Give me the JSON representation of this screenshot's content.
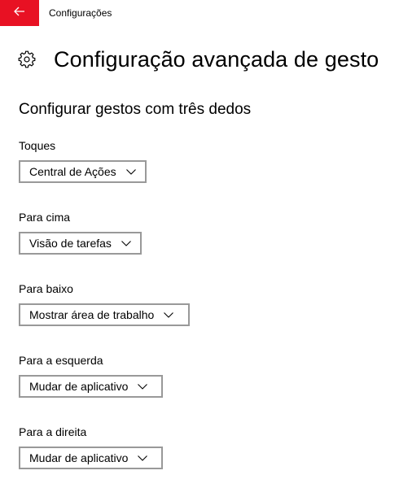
{
  "window": {
    "title": "Configurações",
    "accent_color": "#e81123"
  },
  "header": {
    "icon": "gear-icon",
    "title": "Configuração avançada de gesto"
  },
  "section": {
    "title": "Configurar gestos com três dedos"
  },
  "settings": [
    {
      "label": "Toques",
      "value": "Central de Ações"
    },
    {
      "label": "Para cima",
      "value": "Visão de tarefas"
    },
    {
      "label": "Para baixo",
      "value": "Mostrar área de trabalho"
    },
    {
      "label": "Para a esquerda",
      "value": "Mudar de aplicativo"
    },
    {
      "label": "Para a direita",
      "value": "Mudar de aplicativo"
    }
  ]
}
